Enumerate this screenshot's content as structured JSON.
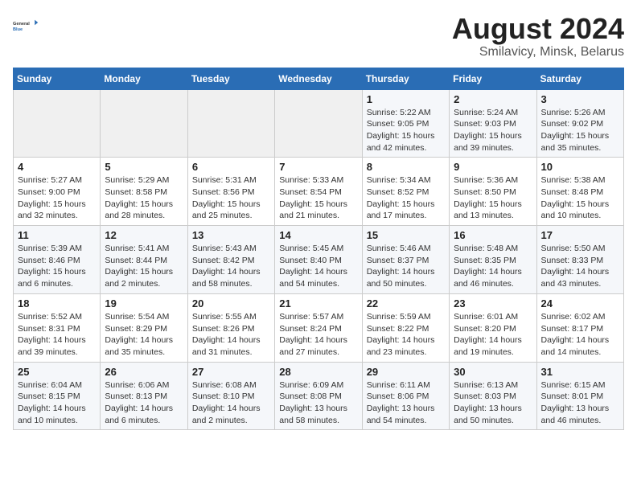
{
  "header": {
    "logo_line1": "General",
    "logo_line2": "Blue",
    "title": "August 2024",
    "subtitle": "Smilavicy, Minsk, Belarus"
  },
  "weekdays": [
    "Sunday",
    "Monday",
    "Tuesday",
    "Wednesday",
    "Thursday",
    "Friday",
    "Saturday"
  ],
  "weeks": [
    [
      {
        "day": "",
        "info": ""
      },
      {
        "day": "",
        "info": ""
      },
      {
        "day": "",
        "info": ""
      },
      {
        "day": "",
        "info": ""
      },
      {
        "day": "1",
        "info": "Sunrise: 5:22 AM\nSunset: 9:05 PM\nDaylight: 15 hours\nand 42 minutes."
      },
      {
        "day": "2",
        "info": "Sunrise: 5:24 AM\nSunset: 9:03 PM\nDaylight: 15 hours\nand 39 minutes."
      },
      {
        "day": "3",
        "info": "Sunrise: 5:26 AM\nSunset: 9:02 PM\nDaylight: 15 hours\nand 35 minutes."
      }
    ],
    [
      {
        "day": "4",
        "info": "Sunrise: 5:27 AM\nSunset: 9:00 PM\nDaylight: 15 hours\nand 32 minutes."
      },
      {
        "day": "5",
        "info": "Sunrise: 5:29 AM\nSunset: 8:58 PM\nDaylight: 15 hours\nand 28 minutes."
      },
      {
        "day": "6",
        "info": "Sunrise: 5:31 AM\nSunset: 8:56 PM\nDaylight: 15 hours\nand 25 minutes."
      },
      {
        "day": "7",
        "info": "Sunrise: 5:33 AM\nSunset: 8:54 PM\nDaylight: 15 hours\nand 21 minutes."
      },
      {
        "day": "8",
        "info": "Sunrise: 5:34 AM\nSunset: 8:52 PM\nDaylight: 15 hours\nand 17 minutes."
      },
      {
        "day": "9",
        "info": "Sunrise: 5:36 AM\nSunset: 8:50 PM\nDaylight: 15 hours\nand 13 minutes."
      },
      {
        "day": "10",
        "info": "Sunrise: 5:38 AM\nSunset: 8:48 PM\nDaylight: 15 hours\nand 10 minutes."
      }
    ],
    [
      {
        "day": "11",
        "info": "Sunrise: 5:39 AM\nSunset: 8:46 PM\nDaylight: 15 hours\nand 6 minutes."
      },
      {
        "day": "12",
        "info": "Sunrise: 5:41 AM\nSunset: 8:44 PM\nDaylight: 15 hours\nand 2 minutes."
      },
      {
        "day": "13",
        "info": "Sunrise: 5:43 AM\nSunset: 8:42 PM\nDaylight: 14 hours\nand 58 minutes."
      },
      {
        "day": "14",
        "info": "Sunrise: 5:45 AM\nSunset: 8:40 PM\nDaylight: 14 hours\nand 54 minutes."
      },
      {
        "day": "15",
        "info": "Sunrise: 5:46 AM\nSunset: 8:37 PM\nDaylight: 14 hours\nand 50 minutes."
      },
      {
        "day": "16",
        "info": "Sunrise: 5:48 AM\nSunset: 8:35 PM\nDaylight: 14 hours\nand 46 minutes."
      },
      {
        "day": "17",
        "info": "Sunrise: 5:50 AM\nSunset: 8:33 PM\nDaylight: 14 hours\nand 43 minutes."
      }
    ],
    [
      {
        "day": "18",
        "info": "Sunrise: 5:52 AM\nSunset: 8:31 PM\nDaylight: 14 hours\nand 39 minutes."
      },
      {
        "day": "19",
        "info": "Sunrise: 5:54 AM\nSunset: 8:29 PM\nDaylight: 14 hours\nand 35 minutes."
      },
      {
        "day": "20",
        "info": "Sunrise: 5:55 AM\nSunset: 8:26 PM\nDaylight: 14 hours\nand 31 minutes."
      },
      {
        "day": "21",
        "info": "Sunrise: 5:57 AM\nSunset: 8:24 PM\nDaylight: 14 hours\nand 27 minutes."
      },
      {
        "day": "22",
        "info": "Sunrise: 5:59 AM\nSunset: 8:22 PM\nDaylight: 14 hours\nand 23 minutes."
      },
      {
        "day": "23",
        "info": "Sunrise: 6:01 AM\nSunset: 8:20 PM\nDaylight: 14 hours\nand 19 minutes."
      },
      {
        "day": "24",
        "info": "Sunrise: 6:02 AM\nSunset: 8:17 PM\nDaylight: 14 hours\nand 14 minutes."
      }
    ],
    [
      {
        "day": "25",
        "info": "Sunrise: 6:04 AM\nSunset: 8:15 PM\nDaylight: 14 hours\nand 10 minutes."
      },
      {
        "day": "26",
        "info": "Sunrise: 6:06 AM\nSunset: 8:13 PM\nDaylight: 14 hours\nand 6 minutes."
      },
      {
        "day": "27",
        "info": "Sunrise: 6:08 AM\nSunset: 8:10 PM\nDaylight: 14 hours\nand 2 minutes."
      },
      {
        "day": "28",
        "info": "Sunrise: 6:09 AM\nSunset: 8:08 PM\nDaylight: 13 hours\nand 58 minutes."
      },
      {
        "day": "29",
        "info": "Sunrise: 6:11 AM\nSunset: 8:06 PM\nDaylight: 13 hours\nand 54 minutes."
      },
      {
        "day": "30",
        "info": "Sunrise: 6:13 AM\nSunset: 8:03 PM\nDaylight: 13 hours\nand 50 minutes."
      },
      {
        "day": "31",
        "info": "Sunrise: 6:15 AM\nSunset: 8:01 PM\nDaylight: 13 hours\nand 46 minutes."
      }
    ]
  ]
}
